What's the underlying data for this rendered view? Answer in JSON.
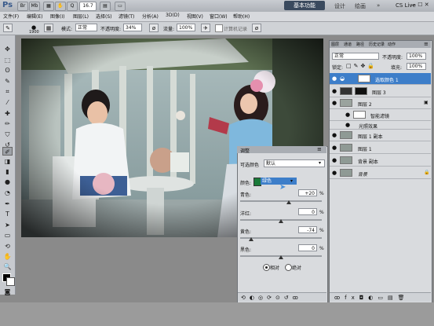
{
  "app": {
    "logo": "Ps",
    "zoom": "16.7",
    "workspace": "基本功能",
    "ws_design": "设计",
    "ws_painting": "绘画",
    "more": "»",
    "cslive": "CS Live",
    "win_controls": "— ☐ ✕"
  },
  "menu": [
    "文件(F)",
    "编辑(E)",
    "图像(I)",
    "图层(L)",
    "选择(S)",
    "滤镜(T)",
    "分析(A)",
    "3D(D)",
    "视图(V)",
    "窗口(W)",
    "帮助(H)"
  ],
  "options": {
    "brush_size": "1900",
    "mode_label": "模式:",
    "mode_value": "正常",
    "opacity_label": "不透明度:",
    "opacity_value": "34%",
    "flow_label": "流量:",
    "flow_value": "100%",
    "airbrush_label": "计算机记录"
  },
  "adjustments": {
    "tab_label": "调整",
    "title_label": "可选颜色",
    "preset_value": "默认",
    "colors_label": "颜色:",
    "colors_value": "绿色",
    "sliders": [
      {
        "label": "青色:",
        "value": "+20",
        "unit": "%",
        "fraction": 0.6
      },
      {
        "label": "洋红:",
        "value": "0",
        "unit": "%",
        "fraction": 0.5
      },
      {
        "label": "黄色:",
        "value": "-74",
        "unit": "%",
        "fraction": 0.13
      },
      {
        "label": "黑色:",
        "value": "0",
        "unit": "%",
        "fraction": 0.5
      }
    ],
    "method_relative": "相对",
    "method_absolute": "绝对"
  },
  "layers": {
    "tabs": [
      "图层",
      "通道",
      "路径",
      "历史记录",
      "动作"
    ],
    "blend_mode": "正常",
    "opacity_label": "不透明度:",
    "opacity_value": "100%",
    "fill_label": "填充:",
    "fill_value": "100%",
    "lock_label": "锁定:",
    "items": [
      {
        "name": "选取颜色 1",
        "selected": true
      },
      {
        "name": "图层 3",
        "selected": false
      },
      {
        "name": "图层 2",
        "selected": false
      },
      {
        "name": "智能滤镜",
        "selected": false
      },
      {
        "name": "光照效果",
        "selected": false
      },
      {
        "name": "图层 1 副本",
        "selected": false
      },
      {
        "name": "图层 1",
        "selected": false
      },
      {
        "name": "背景 副本",
        "selected": false
      },
      {
        "name": "背景",
        "selected": false
      }
    ]
  },
  "colors": {
    "selection": "#3d7ec9",
    "panel": "#d9dbde",
    "workspace": "#8a8a8a"
  }
}
